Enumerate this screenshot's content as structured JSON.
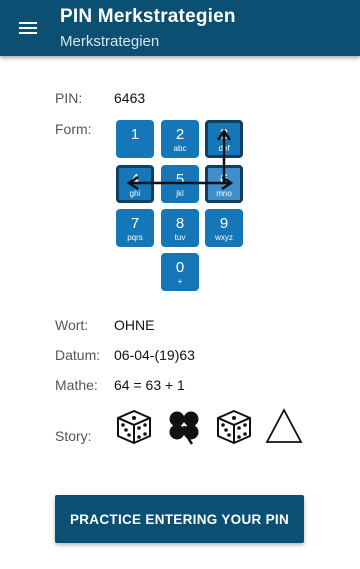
{
  "app_bar": {
    "title": "PIN Merkstrategien",
    "subtitle": "Merkstrategien",
    "menu_icon": "hamburger-menu-icon"
  },
  "fields": {
    "pin_label": "PIN:",
    "pin_value": "6463",
    "form_label": "Form:",
    "word_label": "Wort:",
    "word_value": "OHNE",
    "date_label": "Datum:",
    "date_value": "06-04-(19)63",
    "math_label": "Mathe:",
    "math_value": "64 = 63 + 1",
    "story_label": "Story:"
  },
  "keypad": {
    "keys": [
      {
        "num": "1",
        "sub": ""
      },
      {
        "num": "2",
        "sub": "abc"
      },
      {
        "num": "3",
        "sub": "def"
      },
      {
        "num": "4",
        "sub": "ghi"
      },
      {
        "num": "5",
        "sub": "jkl"
      },
      {
        "num": "6",
        "sub": "mno"
      },
      {
        "num": "7",
        "sub": "pqrs"
      },
      {
        "num": "8",
        "sub": "tuv"
      },
      {
        "num": "9",
        "sub": "wxyz"
      },
      {
        "num": "0",
        "sub": "+"
      }
    ],
    "highlighted": [
      "6",
      "4",
      "6",
      "3"
    ]
  },
  "story": {
    "icons": [
      "dice-icon",
      "four-leaf-clover-icon",
      "dice-icon",
      "triangle-icon"
    ]
  },
  "colors": {
    "primary": "#0b4f72",
    "key": "#1577b8",
    "key_border": "#0f3f5e"
  },
  "practice_button": {
    "label": "PRACTICE ENTERING YOUR PIN"
  }
}
